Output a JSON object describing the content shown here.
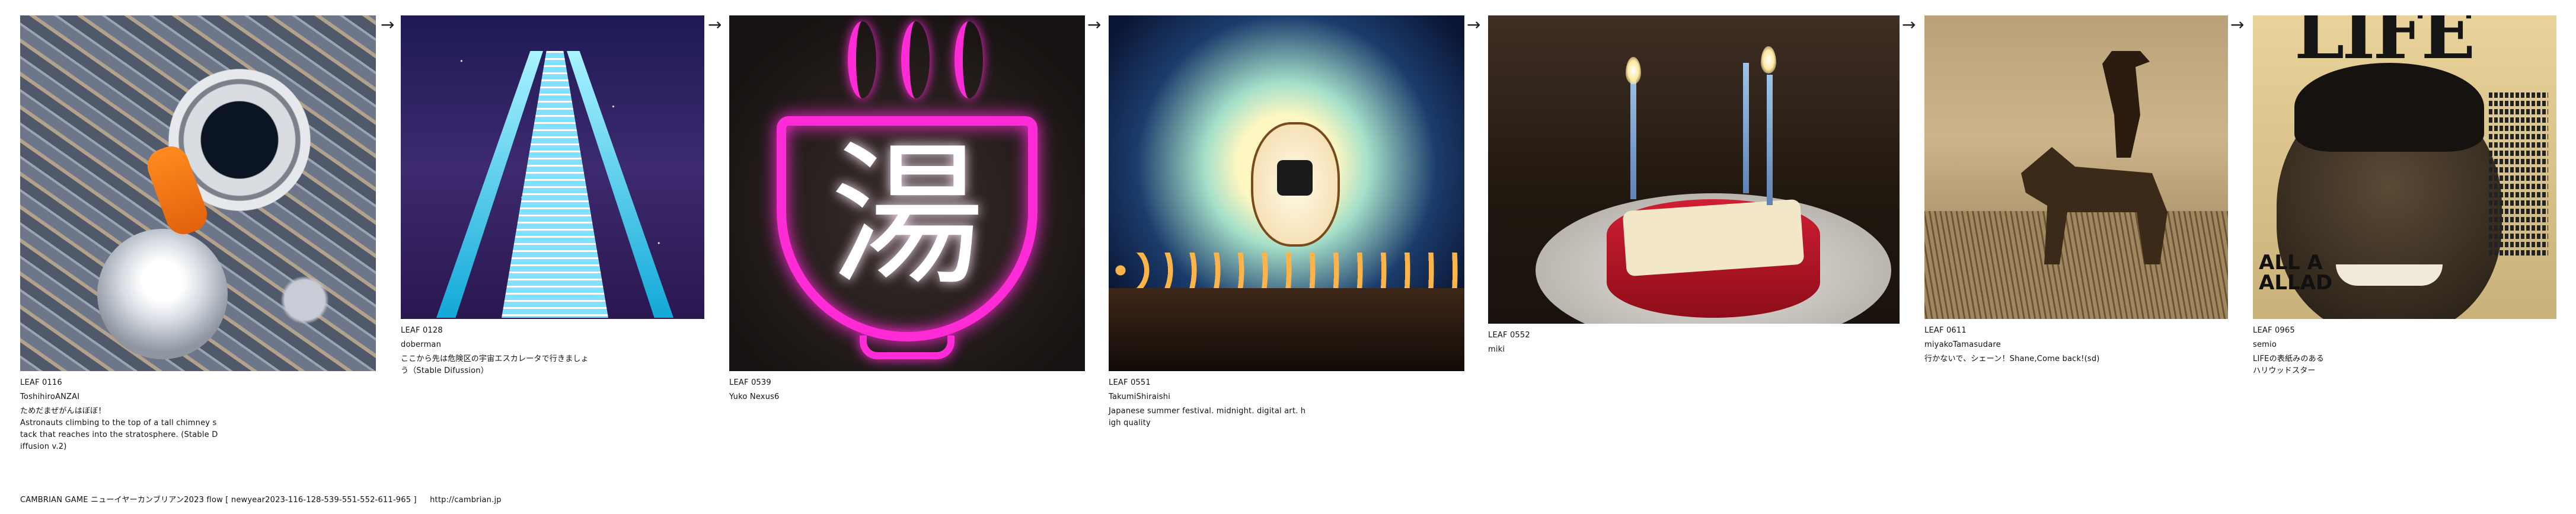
{
  "cards": [
    {
      "leaf": "LEAF 0116",
      "user": "ToshihiroANZAI",
      "text": "ためだまぜがんはぼぼ！\nAstronauts climbing to the top of a tall chimney s\ntack that reaches into the stratosphere. (Stable D\niffusion v.2)",
      "image": "astronaut-over-city"
    },
    {
      "leaf": "LEAF 0128",
      "user": "doberman",
      "text": "ここから先は危険区の宇宙エスカレータで行きましょ\nう（Stable Difussion）",
      "image": "space-escalator"
    },
    {
      "leaf": "LEAF 0539",
      "user": "Yuko Nexus6",
      "text": "",
      "image": "neon-yu-sign",
      "sign_glyph": "湯"
    },
    {
      "leaf": "LEAF 0551",
      "user": "TakumiShiraishi",
      "text": "Japanese summer festival. midnight. digital art. h\nigh quality",
      "image": "summer-festival-lantern"
    },
    {
      "leaf": "LEAF 0552",
      "user": "miki",
      "text": "",
      "image": "birthday-cake"
    },
    {
      "leaf": "LEAF 0611",
      "user": "miyakoTamasudare",
      "text": "行かないで、シェーン！Shane,Come back!(sd)",
      "image": "cowboy-on-horse"
    },
    {
      "leaf": "LEAF 0965",
      "user": "semio",
      "text": "LIFEの表紙みのある\nハリウッドスター",
      "image": "magazine-cover-portrait",
      "cover_masthead": "LIFE",
      "cover_headline": "ALL A\nALLAD"
    }
  ],
  "arrow_glyph": "→",
  "footer": {
    "title": "CAMBRIAN GAME  ニューイヤーカンブリアン2023  flow [ newyear2023-116-128-539-551-552-611-965 ]",
    "url": "http://cambrian.jp"
  }
}
